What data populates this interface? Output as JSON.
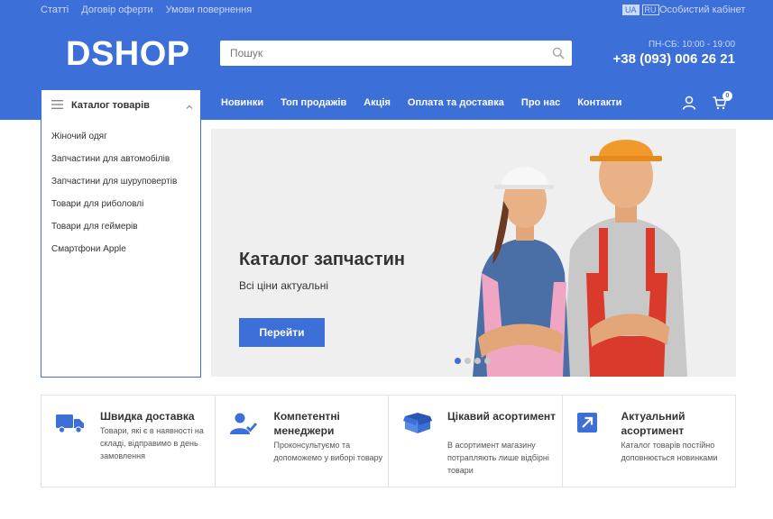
{
  "topbar": {
    "links": [
      "Статті",
      "Договір оферти",
      "Умови повернення"
    ],
    "languages": [
      "UA",
      "RU"
    ],
    "active_language": "UA",
    "cabinet": "Особистий кабінет"
  },
  "header": {
    "logo": "DSHOP",
    "search_placeholder": "Пошук",
    "hours": "ПН-СБ: 10:00 - 19:00",
    "phone": "+38 (093) 006 26 21"
  },
  "catalog": {
    "label": "Каталог товарів",
    "items": [
      "Жіночий одяг",
      "Запчастини для автомобілів",
      "Запчастини для шуруповертів",
      "Товари для риболовлі",
      "Товари для геймерів",
      "Смартфони Apple"
    ]
  },
  "nav": {
    "items": [
      "Новинки",
      "Топ продажів",
      "Акція",
      "Оплата та доставка",
      "Про нас",
      "Контакти"
    ],
    "cart_count": "0"
  },
  "banner": {
    "title": "Каталог запчастин",
    "subtitle": "Всі ціни актуальні",
    "button": "Перейти",
    "slides": 4,
    "active_slide": 1
  },
  "features": [
    {
      "icon": "truck-icon",
      "title": "Швидка доставка",
      "desc": "Товари, які є в наявності на складі, відправимо в день замовлення"
    },
    {
      "icon": "manager-icon",
      "title": "Компетентні менеджери",
      "desc": "Проконсультуємо та допоможемо у виборі товару"
    },
    {
      "icon": "box-icon",
      "title": "Цікавий асортимент",
      "desc": "В асортимент магазину потрапляють лише відбірні товари"
    },
    {
      "icon": "arrow-icon",
      "title": "Актуальний асортимент",
      "desc": "Каталог товарів постійно доповнюється новинками"
    }
  ],
  "colors": {
    "brand": "#3c6fd8",
    "banner_bg": "#efefef"
  }
}
